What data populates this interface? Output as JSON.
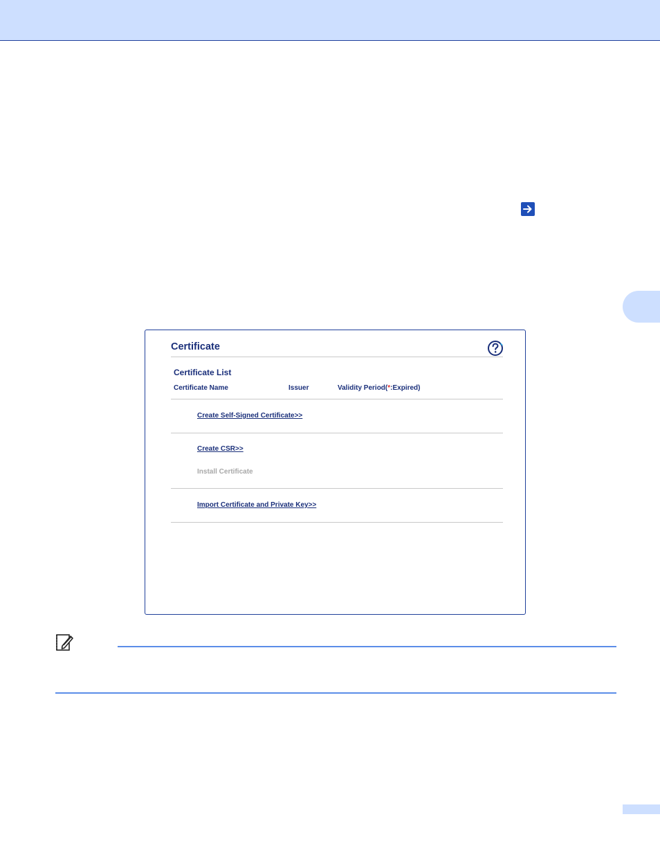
{
  "dialog": {
    "title": "Certificate",
    "list_title": "Certificate List",
    "columns": {
      "name": "Certificate Name",
      "issuer": "Issuer",
      "validity_prefix": "Validity Period(",
      "validity_star": "*",
      "validity_suffix": ":Expired)"
    },
    "links": {
      "self_signed": "Create Self-Signed Certificate>>",
      "csr": "Create CSR>>",
      "install": "Install Certificate",
      "import": "Import Certificate and Private Key>>"
    }
  },
  "icons": {
    "arrow": "arrow-right-icon",
    "help": "help-icon",
    "note": "note-pencil-icon"
  },
  "colors": {
    "band": "#cddfff",
    "text_blue": "#1a2f7a",
    "rule_blue": "#5b8de8",
    "expired_star": "#e03030"
  }
}
